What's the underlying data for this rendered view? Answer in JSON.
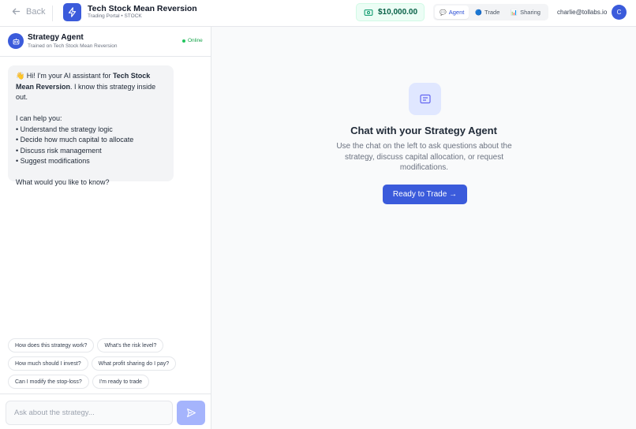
{
  "header": {
    "back_label": "Back",
    "app_title": "Tech Stock Mean Reversion",
    "app_subtitle": "Trading Portal • STOCK",
    "balance": "$10,000.00",
    "tabs": [
      {
        "label": "Agent",
        "icon": "💬",
        "active": true
      },
      {
        "label": "Trade",
        "icon": "🔵",
        "active": false
      },
      {
        "label": "Sharing",
        "icon": "📊",
        "active": false
      }
    ],
    "user_email": "charlie@tollabs.io",
    "avatar_initial": "C"
  },
  "agent": {
    "name": "Strategy Agent",
    "subtitle": "Trained on Tech Stock Mean Reversion",
    "status": "Online"
  },
  "message": {
    "greeting_prefix": "👋 Hi! I'm your AI assistant for ",
    "strategy_name": "Tech Stock Mean Reversion",
    "greeting_suffix": ". I know this strategy inside out.",
    "help_intro": "I can help you:",
    "help_items": [
      "• Understand the strategy logic",
      "• Decide how much capital to allocate",
      "• Discuss risk management",
      "• Suggest modifications"
    ],
    "closing": "What would you like to know?"
  },
  "suggestions": [
    [
      "How does this strategy work?",
      "What's the risk level?"
    ],
    [
      "How much should I invest?",
      "What profit sharing do I pay?"
    ],
    [
      "Can I modify the stop-loss?",
      "I'm ready to trade"
    ]
  ],
  "input": {
    "placeholder": "Ask about the strategy..."
  },
  "hero": {
    "title": "Chat with your Strategy Agent",
    "description": "Use the chat on the left to ask questions about the strategy, discuss capital allocation, or request modifications.",
    "cta_label": "Ready to Trade →"
  },
  "colors": {
    "accent": "#3b5bdb",
    "online": "#22c55e",
    "balance_text": "#065f46"
  }
}
